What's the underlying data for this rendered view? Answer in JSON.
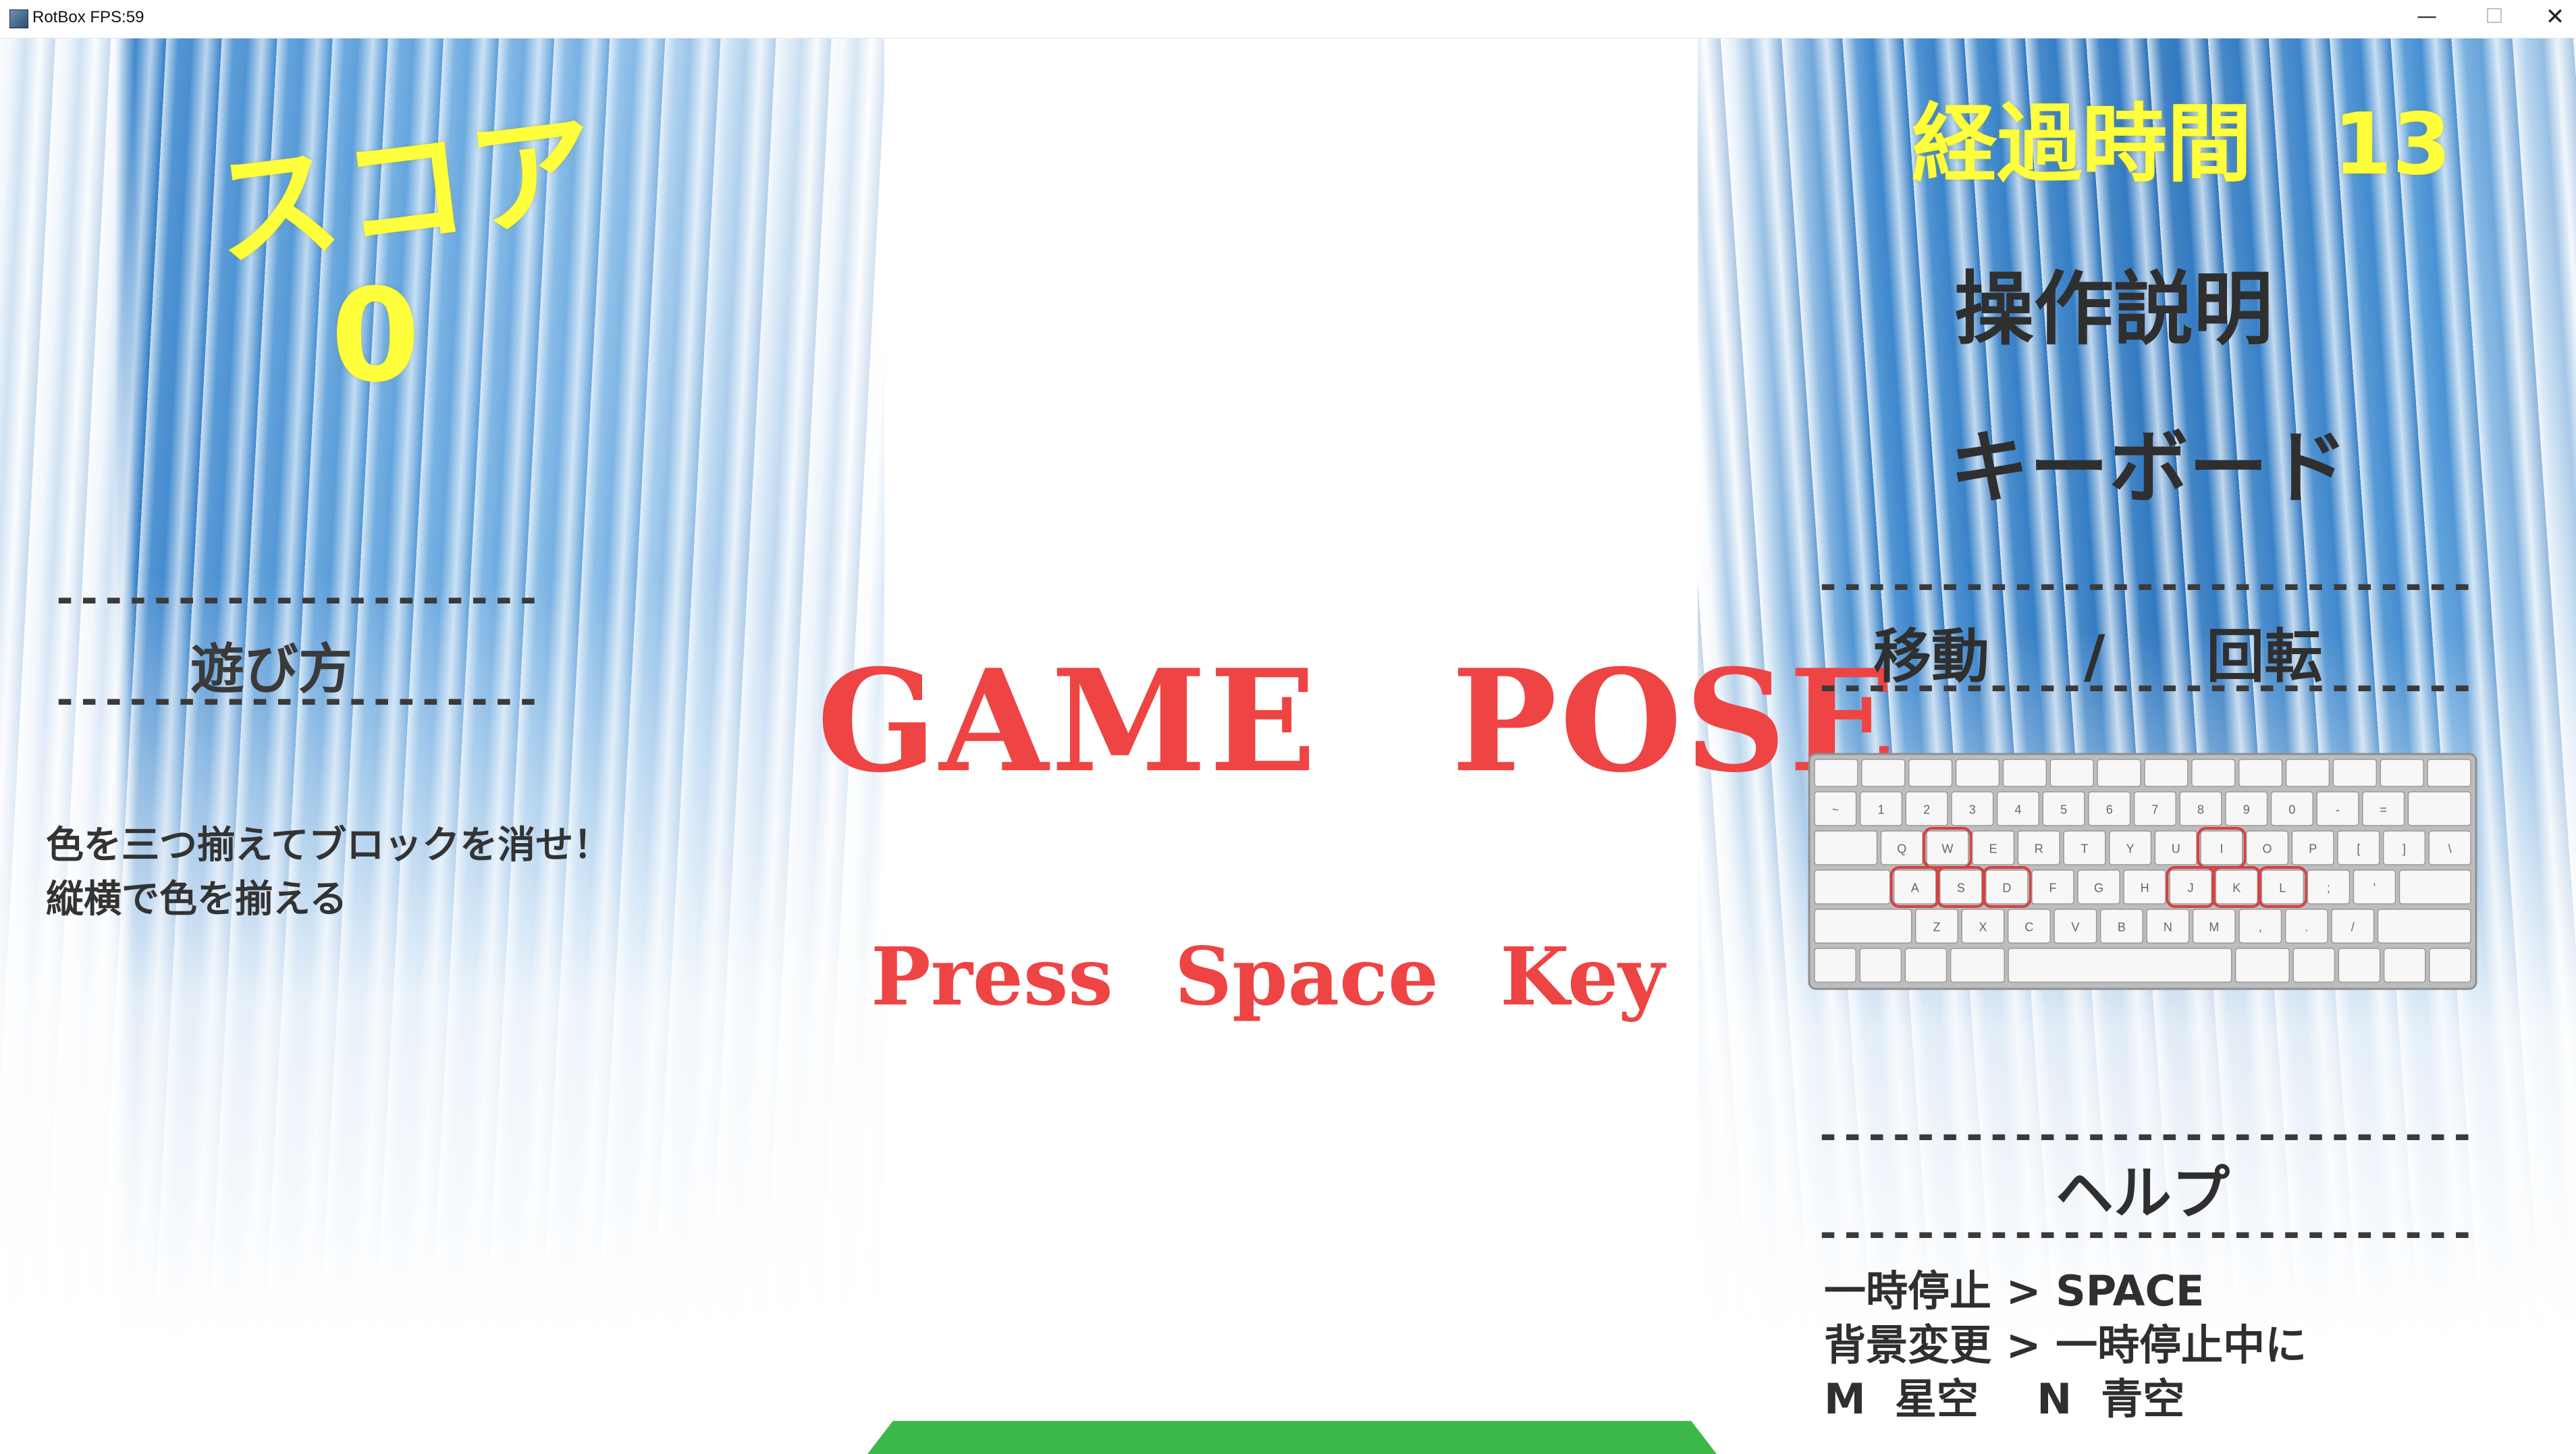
{
  "window": {
    "title": "RotBox FPS:59",
    "minimize_glyph": "—",
    "maximize_glyph": "☐",
    "close_glyph": "✕"
  },
  "score": {
    "label": "スコア",
    "value": "0"
  },
  "how_to_play": {
    "dash": "--------------------",
    "title": "遊び方",
    "line1": "色を三つ揃えてブロックを消せ！",
    "line2": "縦横で色を揃える"
  },
  "pause": {
    "title": "GAME POSE",
    "subtitle": "Press Space Key"
  },
  "elapsed": {
    "label": "経過時間",
    "value": "13"
  },
  "controls": {
    "title": "操作説明",
    "device": "キーボード",
    "dash": "---------------------------",
    "move_label": "移動",
    "separator": "/",
    "rotate_label": "回転",
    "highlighted_keys": [
      "W",
      "A",
      "S",
      "D",
      "I",
      "J",
      "K",
      "L"
    ]
  },
  "help": {
    "dash": "---------------------------",
    "title": "ヘルプ",
    "line1": "一時停止 > SPACE",
    "line2": "背景変更 > 一時停止中に",
    "line3": "M  星空    N  青空"
  },
  "colors": {
    "yellow_text": "#ffff3c",
    "pause_red": "#ee4444",
    "floor_green": "#3cb84a",
    "dark_text": "#2f2f2f",
    "highlight_outline": "#d84040"
  }
}
